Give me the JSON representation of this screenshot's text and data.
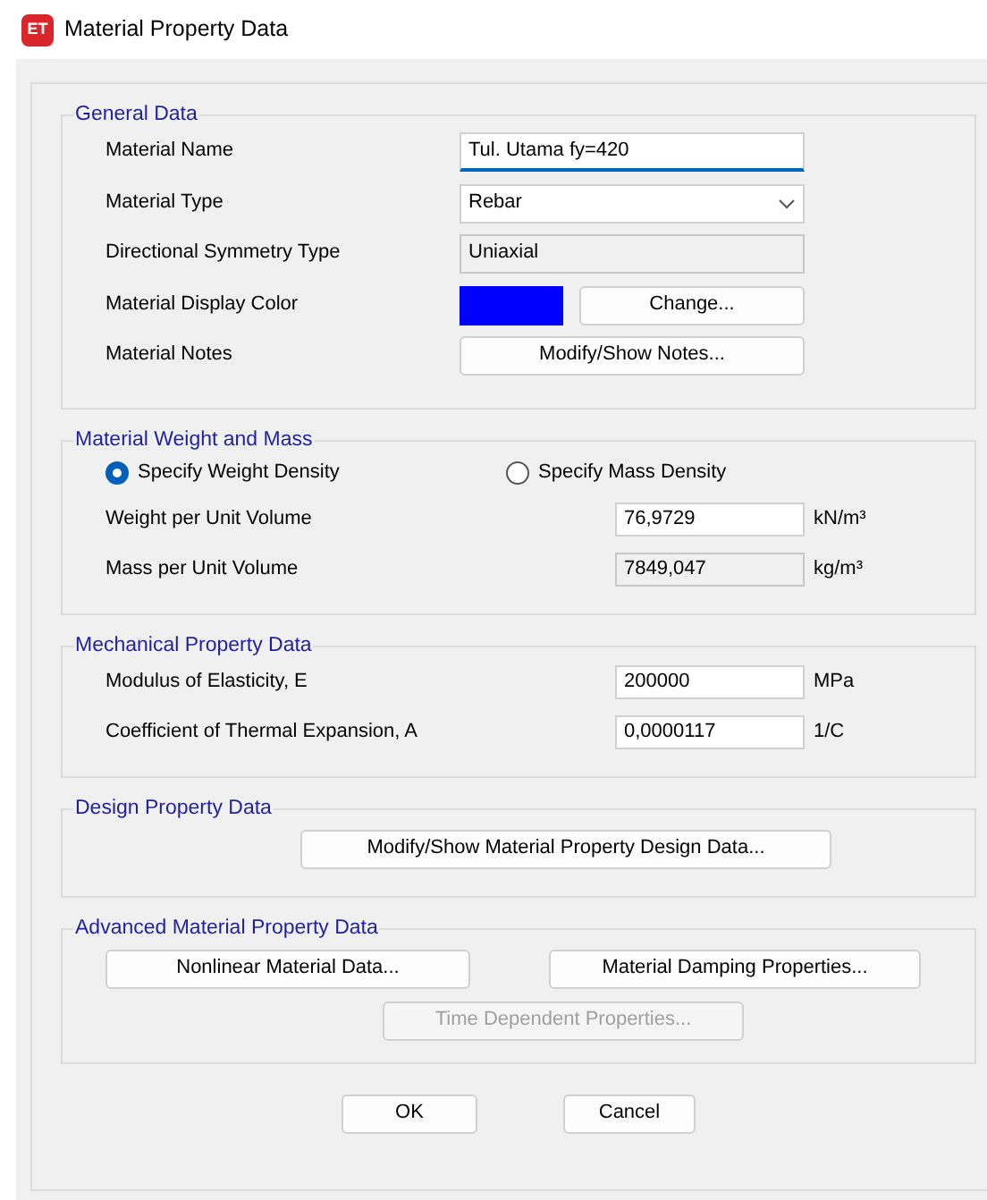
{
  "window": {
    "icon_text": "ET",
    "title": "Material Property Data"
  },
  "groups": [
    {
      "title": "General Data",
      "rows": [
        {
          "kind": "text",
          "label": "Material Name",
          "value": "Tul. Utama fy=420",
          "focused": true
        },
        {
          "kind": "select",
          "label": "Material Type",
          "value": "Rebar"
        },
        {
          "kind": "readonly",
          "label": "Directional Symmetry Type",
          "value": "Uniaxial"
        },
        {
          "kind": "color",
          "label": "Material Display Color",
          "color": "#0000ff",
          "button": "Change..."
        },
        {
          "kind": "button",
          "label": "Material Notes",
          "button": "Modify/Show Notes..."
        }
      ]
    },
    {
      "title": "Material Weight and Mass",
      "rows": [
        {
          "kind": "radios",
          "options": [
            {
              "label": "Specify Weight Density",
              "selected": true
            },
            {
              "label": "Specify Mass Density",
              "selected": false
            }
          ]
        },
        {
          "kind": "number",
          "label": "Weight per Unit Volume",
          "value": "76,9729",
          "unit": "kN/m³",
          "focused": false
        },
        {
          "kind": "readonly-number",
          "label": "Mass per Unit Volume",
          "value": "7849,047",
          "unit": "kg/m³"
        }
      ]
    },
    {
      "title": "Mechanical Property Data",
      "rows": [
        {
          "kind": "number",
          "label": "Modulus of Elasticity,  E",
          "value": "200000",
          "unit": "MPa",
          "focused": false
        },
        {
          "kind": "number",
          "label": "Coefficient of Thermal Expansion,  A",
          "value": "0,0000117",
          "unit": "1/C",
          "focused": false
        }
      ]
    },
    {
      "title": "Design Property Data",
      "rows": [
        {
          "kind": "buttons",
          "buttons": [
            {
              "label": "Modify/Show Material Property Design Data...",
              "disabled": false
            }
          ]
        }
      ]
    },
    {
      "title": "Advanced Material Property Data",
      "rows": [
        {
          "kind": "buttons",
          "buttons": [
            {
              "label": "Nonlinear Material Data...",
              "disabled": false
            },
            {
              "label": "Material Damping Properties...",
              "disabled": false
            }
          ]
        },
        {
          "kind": "buttons",
          "buttons": [
            {
              "label": "Time Dependent Properties...",
              "disabled": true
            }
          ]
        }
      ]
    }
  ],
  "footer_buttons": [
    "OK",
    "Cancel"
  ]
}
